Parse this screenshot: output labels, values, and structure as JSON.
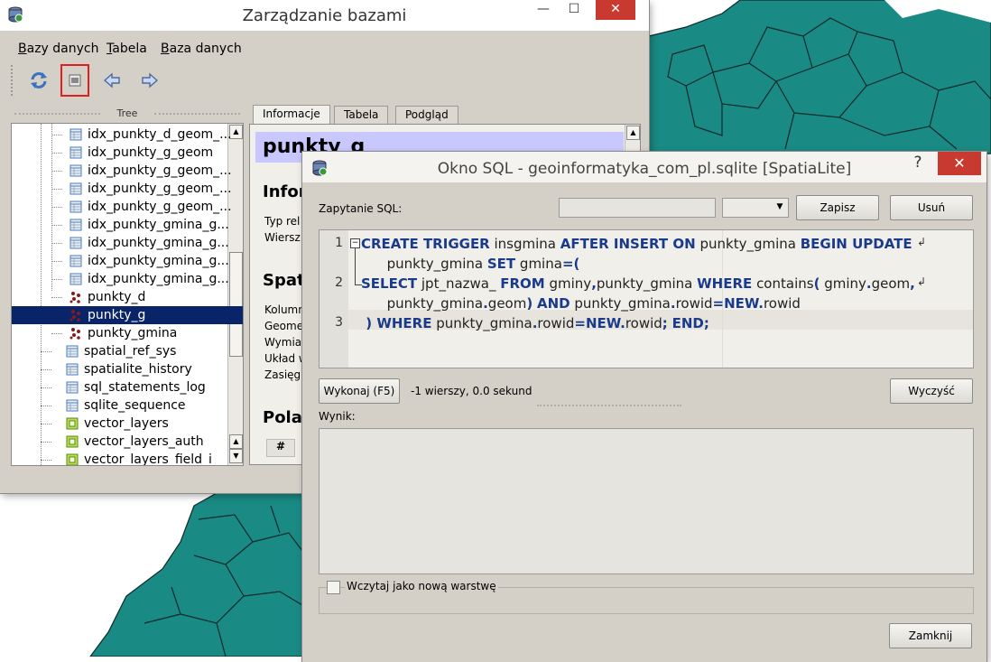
{
  "main_window": {
    "title": "Zarządzanie bazami",
    "menu": [
      {
        "label": "Bazy danych",
        "accel": "B"
      },
      {
        "label": "Tabela",
        "accel": "T"
      },
      {
        "label": "Baza danych",
        "accel": "B"
      }
    ],
    "toolbar": [
      "refresh-icon",
      "sql-window-icon",
      "import-icon",
      "export-icon"
    ],
    "tree_header": "Tree",
    "tree_items": [
      {
        "label": "idx_punkty_d_geom_...",
        "icon": "table-icon"
      },
      {
        "label": "idx_punkty_g_geom",
        "icon": "table-icon"
      },
      {
        "label": "idx_punkty_g_geom_...",
        "icon": "table-icon"
      },
      {
        "label": "idx_punkty_g_geom_...",
        "icon": "table-icon"
      },
      {
        "label": "idx_punkty_g_geom_...",
        "icon": "table-icon"
      },
      {
        "label": "idx_punkty_gmina_g...",
        "icon": "table-icon"
      },
      {
        "label": "idx_punkty_gmina_g...",
        "icon": "table-icon"
      },
      {
        "label": "idx_punkty_gmina_g...",
        "icon": "table-icon"
      },
      {
        "label": "idx_punkty_gmina_g...",
        "icon": "table-icon"
      },
      {
        "label": "punkty_d",
        "icon": "point-layer-icon"
      },
      {
        "label": "punkty_g",
        "icon": "point-layer-icon",
        "selected": true
      },
      {
        "label": "punkty_gmina",
        "icon": "point-layer-icon"
      },
      {
        "label": "spatial_ref_sys",
        "icon": "table-icon"
      },
      {
        "label": "spatialite_history",
        "icon": "table-icon"
      },
      {
        "label": "sql_statements_log",
        "icon": "table-icon"
      },
      {
        "label": "sqlite_sequence",
        "icon": "table-icon"
      },
      {
        "label": "vector_layers",
        "icon": "view-icon"
      },
      {
        "label": "vector_layers_auth",
        "icon": "view-icon"
      },
      {
        "label": "vector_layers_field_i",
        "icon": "view-icon"
      }
    ],
    "tabs": [
      "Informacje",
      "Tabela",
      "Podgląd"
    ],
    "info": {
      "title": "punkty_g",
      "section1": "Infor",
      "rows1": [
        "Typ rel",
        "Wiersz"
      ],
      "section2": "Spat",
      "rows2": [
        "Kolumn",
        "Geome",
        "Wymia",
        "Układ w",
        "Zasięg:"
      ],
      "section3": "Pola",
      "hash": "#"
    }
  },
  "sql_window": {
    "title": "Okno SQL - geoinformatyka_com_pl.sqlite [SpatiaLite]",
    "help": "?",
    "close": "✕",
    "query_label": "Zapytanie SQL:",
    "save_button": "Zapisz",
    "delete_button": "Usuń",
    "code_lines": [
      {
        "num": "1",
        "tokens": [
          {
            "t": "CREATE TRIGGER",
            "k": true
          },
          {
            "t": " insgmina "
          },
          {
            "t": "AFTER INSERT ON",
            "k": true
          },
          {
            "t": " punkty_gmina "
          },
          {
            "t": "BEGIN UPDATE",
            "k": true
          }
        ]
      },
      {
        "num": "",
        "tokens": [
          {
            "t": "      punkty_gmina "
          },
          {
            "t": "SET",
            "k": true
          },
          {
            "t": " gmina"
          },
          {
            "t": "=(",
            "k": true
          }
        ]
      },
      {
        "num": "2",
        "tokens": [
          {
            "t": "SELECT",
            "k": true
          },
          {
            "t": " jpt_nazwa_ "
          },
          {
            "t": "FROM",
            "k": true
          },
          {
            "t": " gminy"
          },
          {
            "t": ",",
            "k": true
          },
          {
            "t": "punkty_gmina "
          },
          {
            "t": "WHERE",
            "k": true
          },
          {
            "t": " contains"
          },
          {
            "t": "(",
            "k": true
          },
          {
            "t": " gminy"
          },
          {
            "t": ".",
            "k": true
          },
          {
            "t": "geom"
          },
          {
            "t": ",",
            "k": true
          }
        ]
      },
      {
        "num": "",
        "tokens": [
          {
            "t": "      punkty_gmina"
          },
          {
            "t": ".",
            "k": true
          },
          {
            "t": "geom"
          },
          {
            "t": ")",
            "k": true
          },
          {
            "t": " "
          },
          {
            "t": "AND",
            "k": true
          },
          {
            "t": " punkty_gmina"
          },
          {
            "t": ".",
            "k": true
          },
          {
            "t": "rowid"
          },
          {
            "t": "=",
            "k": true
          },
          {
            "t": "NEW",
            "k": true
          },
          {
            "t": ".",
            "k": true
          },
          {
            "t": "rowid"
          }
        ]
      },
      {
        "num": "3",
        "tokens": [
          {
            "t": " ) ",
            "k": true
          },
          {
            "t": "WHERE",
            "k": true
          },
          {
            "t": " punkty_gmina"
          },
          {
            "t": ".",
            "k": true
          },
          {
            "t": "rowid"
          },
          {
            "t": "=",
            "k": true
          },
          {
            "t": "NEW",
            "k": true
          },
          {
            "t": ".",
            "k": true
          },
          {
            "t": "rowid"
          },
          {
            "t": ";",
            "k": true
          },
          {
            "t": " "
          },
          {
            "t": "END;",
            "k": true
          }
        ]
      }
    ],
    "execute_button": "Wykonaj (F5)",
    "status": "-1 wierszy, 0.0 sekund",
    "clear_button": "Wyczyść",
    "result_label": "Wynik:",
    "load_layer_label": "Wczytaj jako nową warstwę",
    "close_button": "Zamknij"
  },
  "colors": {
    "map_fill": "#1a8a84",
    "selection": "#0a246a",
    "keyword": "#1a3a8c",
    "close_red": "#c83a2f"
  }
}
